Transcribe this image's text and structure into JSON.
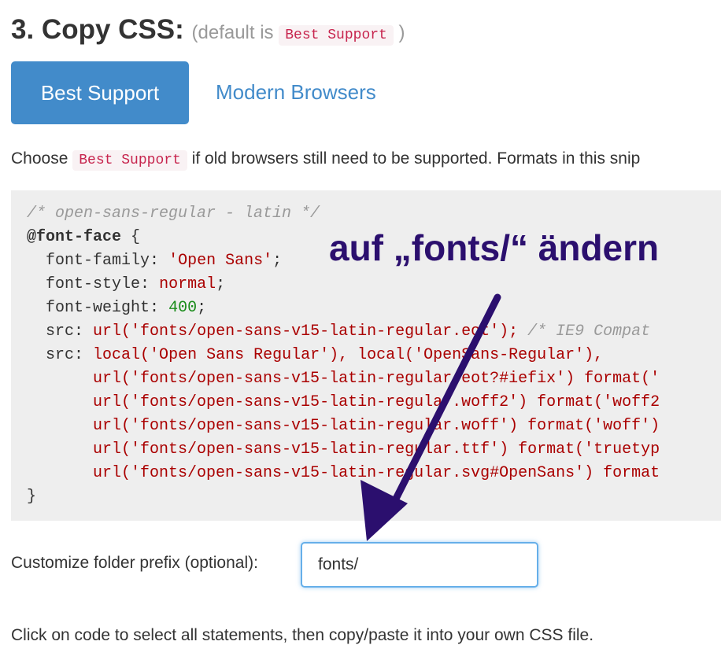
{
  "section": {
    "number_title": "3. Copy CSS:",
    "default_prefix": "(default is",
    "default_value": "Best Support",
    "default_suffix": ")"
  },
  "tabs": {
    "best_support": "Best Support",
    "modern_browsers": "Modern Browsers"
  },
  "description": {
    "before": "Choose",
    "tag": "Best Support",
    "after": "if old browsers still need to be supported. Formats in this snip"
  },
  "code": {
    "comment_header": "/* open-sans-regular - latin */",
    "at_rule": "@font-face",
    "open_brace": "{",
    "font_family_prop": "font-family:",
    "font_family_val": "'Open Sans'",
    "font_style_prop": "font-style:",
    "font_style_val": "normal",
    "font_weight_prop": "font-weight:",
    "font_weight_val": "400",
    "src1_prop": "src:",
    "src1_val": "url('fonts/open-sans-v15-latin-regular.eot');",
    "src1_comment": "/* IE9 Compat",
    "src2_prop": "src:",
    "src2_line1": "local('Open Sans Regular'), local('OpenSans-Regular'),",
    "src2_line2": "url('fonts/open-sans-v15-latin-regular.eot?#iefix') format('",
    "src2_line3": "url('fonts/open-sans-v15-latin-regular.woff2') format('woff2",
    "src2_line4": "url('fonts/open-sans-v15-latin-regular.woff') format('woff')",
    "src2_line5": "url('fonts/open-sans-v15-latin-regular.ttf') format('truetyp",
    "src2_line6": "url('fonts/open-sans-v15-latin-regular.svg#OpenSans') format",
    "close_brace": "}"
  },
  "annotation": {
    "text": "auf „fonts/“ ändern",
    "color": "#2b0f6e"
  },
  "prefix": {
    "label": "Customize folder prefix (optional):",
    "value": "fonts/"
  },
  "footer": {
    "note": "Click on code to select all statements, then copy/paste it into your own CSS file."
  },
  "colors": {
    "primary": "#428bca",
    "code_background": "#eeeeee",
    "code_string": "#a00",
    "tag_text": "#c7254e"
  }
}
